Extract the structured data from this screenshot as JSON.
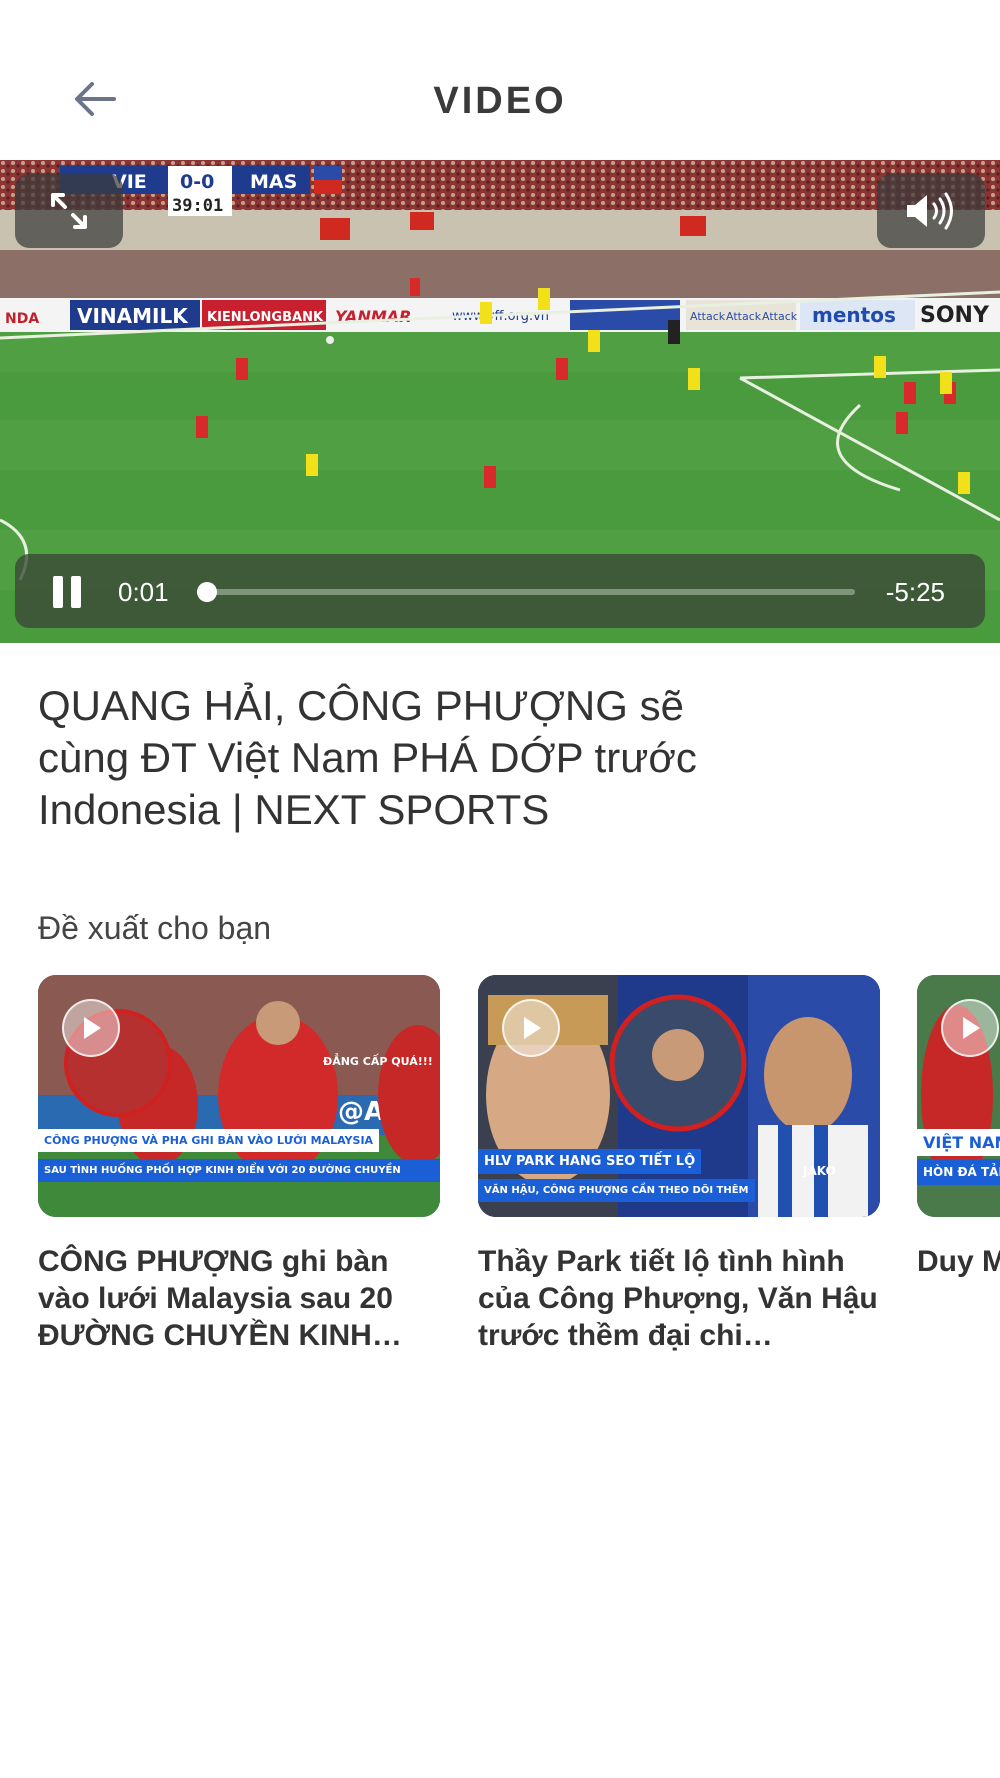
{
  "header": {
    "title": "VIDEO",
    "back_icon": "arrow-left-icon"
  },
  "player": {
    "time_elapsed": "0:01",
    "time_remaining": "-5:25",
    "progress": 0.003,
    "expand_icon": "expand-icon",
    "volume_icon": "volume-icon",
    "pause_icon": "pause-icon",
    "scoreboard": {
      "home": "VIE",
      "score": "0-0",
      "away": "MAS",
      "clock": "39:01"
    },
    "ad_boards": [
      "NDA",
      "VINAMILK",
      "KIENLONGBANK",
      "YANMAR",
      "www.vff.org.vn",
      "Attack",
      "Attack",
      "Attack",
      "mentos",
      "SONY"
    ]
  },
  "video_title": "QUANG HẢI, CÔNG PHƯỢNG sẽ cùng ĐT Việt Nam PHÁ DỚP trước Indonesia | NEXT SPORTS",
  "recommendations": {
    "label": "Đề xuất cho bạn",
    "items": [
      {
        "title": "CÔNG PHƯỢNG ghi bàn vào lưới Malaysia sau 20 ĐƯỜNG CHUYỀN KINH…",
        "caption_1": "CÔNG PHƯỢNG VÀ PHA GHI BÀN VÀO LƯỚI MALAYSIA",
        "caption_2": "SAU TÌNH HUỐNG PHỐI HỢP KINH ĐIỂN VỚI 20 ĐƯỜNG CHUYỀN",
        "tag": "ĐẲNG CẤP QUÁ!!!",
        "board": "@AFF"
      },
      {
        "title": "Thầy Park tiết lộ tình hình của Công Phượng, Văn Hậu trước thềm đại chi…",
        "caption_1": "HLV PARK HANG SEO TIẾT LỘ",
        "caption_2": "VĂN HẬU, CÔNG PHƯỢNG CẦN THEO DÕI THÊM",
        "jersey": "JAKO"
      },
      {
        "title": "Duy M… ĐỈNH… Malay…",
        "caption_1": "VIỆT NAM",
        "caption_2": "HÒN ĐÁ TẢN"
      }
    ]
  },
  "colors": {
    "caption_blue": "#1a5fd6",
    "pitch_green": "#4a9a3e",
    "text_dark": "#333333"
  }
}
